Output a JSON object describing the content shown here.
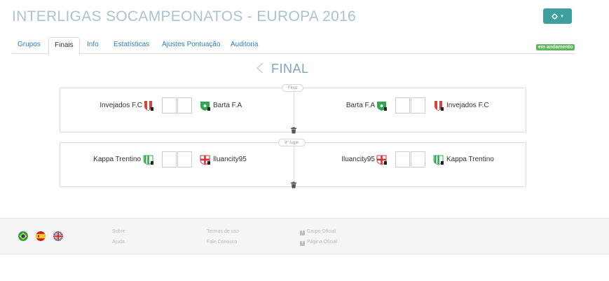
{
  "header": {
    "title": "INTERLIGAS SOCAMPEONATOS - EUROPA 2016",
    "settings_icon": "gear-icon",
    "settings_caret": "▾"
  },
  "tabs": [
    {
      "label": "Grupos",
      "active": false
    },
    {
      "label": "Finais",
      "active": true
    },
    {
      "label": "Info",
      "active": false
    },
    {
      "label": "Estatísticas",
      "active": false
    },
    {
      "label": "Ajustes Pontuação",
      "active": false
    },
    {
      "label": "Auditoria",
      "active": false
    }
  ],
  "status_badge": "em andamento",
  "section": {
    "back_icon": "chevron-left-icon",
    "title": "FINAL"
  },
  "matches": [
    {
      "label": "Final",
      "legs": [
        {
          "home": "Invejados F.C",
          "home_crest": "red-white-shield-crest",
          "away": "Barta F.A",
          "away_crest": "green-shield-crest",
          "home_score": "",
          "away_score": ""
        },
        {
          "home": "Barta F.A",
          "home_crest": "green-shield-crest",
          "away": "Invejados F.C",
          "away_crest": "red-white-shield-crest",
          "home_score": "",
          "away_score": ""
        }
      ]
    },
    {
      "label": "9º lugar",
      "legs": [
        {
          "home": "Kappa Trentino",
          "home_crest": "green-white-stripes-crest",
          "away": "Iluancity95",
          "away_crest": "red-cross-crest",
          "home_score": "",
          "away_score": ""
        },
        {
          "home": "Iluancity95",
          "home_crest": "red-cross-crest",
          "away": "Kappa Trentino",
          "away_crest": "green-white-stripes-crest",
          "home_score": "",
          "away_score": ""
        }
      ]
    }
  ],
  "footer": {
    "flags": [
      "brazil-flag-icon",
      "spain-flag-icon",
      "uk-flag-icon"
    ],
    "col1": [
      "Sobre",
      "Ajuda"
    ],
    "col2": [
      "Termos de uso",
      "Fale Conosco"
    ],
    "col3": [
      "Grupo Oficial",
      "Página Oficial"
    ],
    "fb_glyph": "f"
  },
  "colors": {
    "title": "#a9c3d3",
    "accent": "#3f9e9e",
    "badge": "#5cb85c",
    "link": "#2f7fbf"
  }
}
